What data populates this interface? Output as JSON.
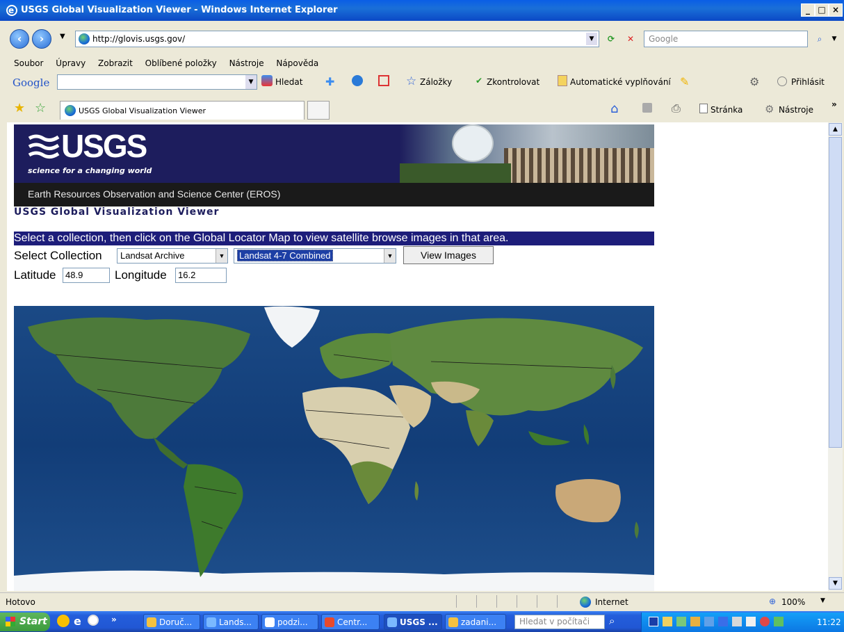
{
  "window": {
    "title": "USGS Global Visualization Viewer - Windows Internet Explorer"
  },
  "address": {
    "url": "http://glovis.usgs.gov/",
    "search_placeholder": "Google"
  },
  "menu": {
    "items": [
      "Soubor",
      "Úpravy",
      "Zobrazit",
      "Oblíbené položky",
      "Nástroje",
      "Nápověda"
    ]
  },
  "google_toolbar": {
    "logo": "Google",
    "search_label": "Hledat",
    "bookmarks_label": "Záložky",
    "spellcheck_label": "Zkontrolovat",
    "autofill_label": "Automatické vyplňování",
    "signin_label": "Přihlásit"
  },
  "tabs": {
    "active_title": "USGS Global Visualization Viewer",
    "page_label": "Stránka",
    "tools_label": "Nástroje"
  },
  "page": {
    "logo_text": "USGS",
    "tagline": "science for a changing world",
    "center_name": "Earth Resources Observation and Science Center (EROS)",
    "title": "USGS Global Visualization Viewer",
    "instruction": "Select a collection, then click on the Global Locator Map to view satellite browse images in that area.",
    "select_collection_label": "Select Collection",
    "collection_value": "Landsat Archive",
    "dataset_value": "Landsat 4-7 Combined",
    "view_images_label": "View Images",
    "latitude_label": "Latitude",
    "latitude_value": "48.9",
    "longitude_label": "Longitude",
    "longitude_value": "16.2"
  },
  "status": {
    "text": "Hotovo",
    "zone": "Internet",
    "zoom": "100%"
  },
  "taskbar": {
    "start_label": "Start",
    "tasks": [
      "Doruč...",
      "Lands...",
      "podzi...",
      "Centr...",
      "USGS ...",
      "zadani..."
    ],
    "search_placeholder": "Hledat v počítači",
    "clock": "11:22"
  },
  "colors": {
    "titlebar": "#0a5ee6",
    "usgs_navy": "#1d1d5d",
    "instruction_bg": "#1d1d7a",
    "ocean": "#17427a",
    "land": "#4d7a3a",
    "desert": "#d8cfae"
  }
}
